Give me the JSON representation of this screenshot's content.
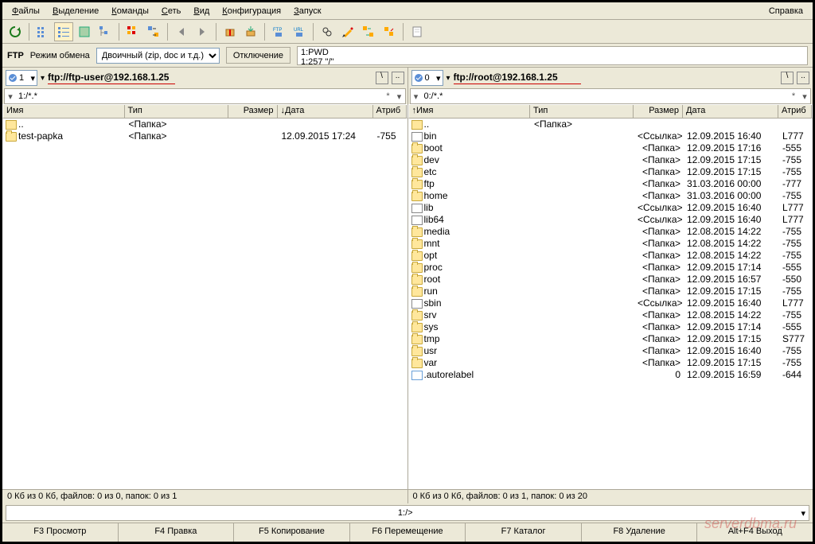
{
  "menu": {
    "items": [
      "Файлы",
      "Выделение",
      "Команды",
      "Сеть",
      "Вид",
      "Конфигурация",
      "Запуск"
    ],
    "help": "Справка"
  },
  "modebar": {
    "ftp": "FTP",
    "mode_label": "Режим обмена",
    "mode_value": "Двоичный (zip, doc и т.д.)",
    "disconnect": "Отключение",
    "log1": "1:PWD",
    "log2": "1:257 \"/\""
  },
  "headers": {
    "name": "Имя",
    "type": "Тип",
    "size": "Размер",
    "date": "Дата",
    "attr": "Атриб"
  },
  "left": {
    "drive": "1",
    "address": "ftp://ftp-user@192.168.1.25",
    "path": "1:/*.*",
    "rows": [
      {
        "icon": "up",
        "name": "..",
        "type": "<Папка>",
        "size": "",
        "date": "",
        "attr": ""
      },
      {
        "icon": "folder",
        "name": "test-papka",
        "type": "<Папка>",
        "size": "",
        "date": "12.09.2015 17:24",
        "attr": "-755"
      }
    ],
    "status": "0 Кб из 0 Кб, файлов: 0 из 0, папок: 0 из 1"
  },
  "right": {
    "drive": "0",
    "address": "ftp://root@192.168.1.25",
    "path": "0:/*.*",
    "rows": [
      {
        "icon": "up",
        "name": "..",
        "type": "<Папка>",
        "size": "",
        "date": "",
        "attr": ""
      },
      {
        "icon": "link",
        "name": "bin",
        "type": "",
        "size": "<Ссылка>",
        "date": "12.09.2015 16:40",
        "attr": "L777"
      },
      {
        "icon": "folder",
        "name": "boot",
        "type": "",
        "size": "<Папка>",
        "date": "12.09.2015 17:16",
        "attr": "-555"
      },
      {
        "icon": "folder",
        "name": "dev",
        "type": "",
        "size": "<Папка>",
        "date": "12.09.2015 17:15",
        "attr": "-755"
      },
      {
        "icon": "folder",
        "name": "etc",
        "type": "",
        "size": "<Папка>",
        "date": "12.09.2015 17:15",
        "attr": "-755"
      },
      {
        "icon": "folder",
        "name": "ftp",
        "type": "",
        "size": "<Папка>",
        "date": "31.03.2016 00:00",
        "attr": "-777"
      },
      {
        "icon": "folder",
        "name": "home",
        "type": "",
        "size": "<Папка>",
        "date": "31.03.2016 00:00",
        "attr": "-755"
      },
      {
        "icon": "link",
        "name": "lib",
        "type": "",
        "size": "<Ссылка>",
        "date": "12.09.2015 16:40",
        "attr": "L777"
      },
      {
        "icon": "link",
        "name": "lib64",
        "type": "",
        "size": "<Ссылка>",
        "date": "12.09.2015 16:40",
        "attr": "L777"
      },
      {
        "icon": "folder",
        "name": "media",
        "type": "",
        "size": "<Папка>",
        "date": "12.08.2015 14:22",
        "attr": "-755"
      },
      {
        "icon": "folder",
        "name": "mnt",
        "type": "",
        "size": "<Папка>",
        "date": "12.08.2015 14:22",
        "attr": "-755"
      },
      {
        "icon": "folder",
        "name": "opt",
        "type": "",
        "size": "<Папка>",
        "date": "12.08.2015 14:22",
        "attr": "-755"
      },
      {
        "icon": "folder",
        "name": "proc",
        "type": "",
        "size": "<Папка>",
        "date": "12.09.2015 17:14",
        "attr": "-555"
      },
      {
        "icon": "folder",
        "name": "root",
        "type": "",
        "size": "<Папка>",
        "date": "12.09.2015 16:57",
        "attr": "-550"
      },
      {
        "icon": "folder",
        "name": "run",
        "type": "",
        "size": "<Папка>",
        "date": "12.09.2015 17:15",
        "attr": "-755"
      },
      {
        "icon": "link",
        "name": "sbin",
        "type": "",
        "size": "<Ссылка>",
        "date": "12.09.2015 16:40",
        "attr": "L777"
      },
      {
        "icon": "folder",
        "name": "srv",
        "type": "",
        "size": "<Папка>",
        "date": "12.08.2015 14:22",
        "attr": "-755"
      },
      {
        "icon": "folder",
        "name": "sys",
        "type": "",
        "size": "<Папка>",
        "date": "12.09.2015 17:14",
        "attr": "-555"
      },
      {
        "icon": "folder",
        "name": "tmp",
        "type": "",
        "size": "<Папка>",
        "date": "12.09.2015 17:15",
        "attr": "S777"
      },
      {
        "icon": "folder",
        "name": "usr",
        "type": "",
        "size": "<Папка>",
        "date": "12.09.2015 16:40",
        "attr": "-755"
      },
      {
        "icon": "folder",
        "name": "var",
        "type": "",
        "size": "<Папка>",
        "date": "12.09.2015 17:15",
        "attr": "-755"
      },
      {
        "icon": "file",
        "name": ".autorelabel",
        "type": "",
        "size": "0",
        "date": "12.09.2015 16:59",
        "attr": "-644"
      }
    ],
    "status": "0 Кб из 0 Кб, файлов: 0 из 1, папок: 0 из 20"
  },
  "bottom_path": "1:/>",
  "fkeys": [
    "F3 Просмотр",
    "F4 Правка",
    "F5 Копирование",
    "F6 Перемещение",
    "F7 Каталог",
    "F8 Удаление",
    "Alt+F4 Выход"
  ]
}
